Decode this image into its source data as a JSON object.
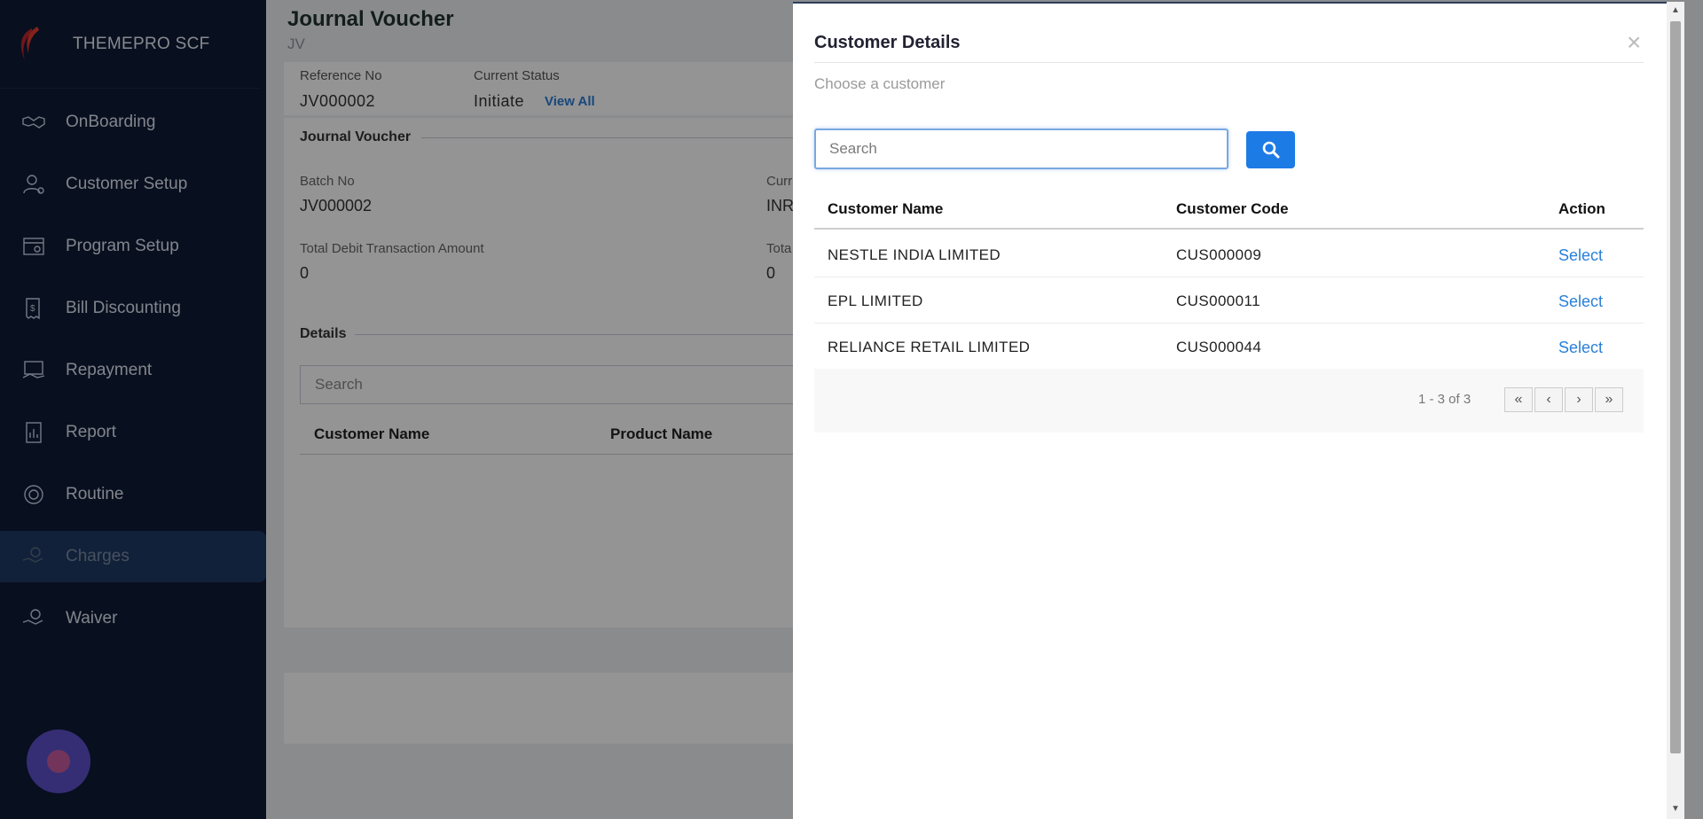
{
  "brand": {
    "name": "THEMEPRO SCF"
  },
  "sidebar": {
    "items": [
      {
        "label": "OnBoarding",
        "icon": "handshake-icon"
      },
      {
        "label": "Customer Setup",
        "icon": "user-gear-icon"
      },
      {
        "label": "Program Setup",
        "icon": "program-icon"
      },
      {
        "label": "Bill Discounting",
        "icon": "bill-icon"
      },
      {
        "label": "Repayment",
        "icon": "repayment-icon"
      },
      {
        "label": "Report",
        "icon": "report-icon"
      },
      {
        "label": "Routine",
        "icon": "routine-icon"
      },
      {
        "label": "Charges",
        "icon": "charges-icon",
        "active": true
      },
      {
        "label": "Waiver",
        "icon": "waiver-icon"
      }
    ]
  },
  "page": {
    "title": "Journal Voucher",
    "subtitle": "JV",
    "reference_label": "Reference No",
    "reference_value": "JV000002",
    "status_label": "Current Status",
    "status_value": "Initiate",
    "view_all": "View All",
    "section_title": "Journal Voucher",
    "batch_label": "Batch No",
    "batch_value": "JV000002",
    "currency_label_partial": "Curr",
    "currency_value_partial": "INR",
    "total_debit_label": "Total Debit Transaction Amount",
    "total_debit_value": "0",
    "total_credit_label_partial": "Tota",
    "total_credit_value": "0",
    "details_title": "Details",
    "details_search_placeholder": "Search",
    "details_columns": [
      "Customer Name",
      "Product Name"
    ]
  },
  "drawer": {
    "title": "Customer Details",
    "close": "×",
    "subtitle": "Choose a customer",
    "search_placeholder": "Search",
    "columns": {
      "name": "Customer Name",
      "code": "Customer Code",
      "action": "Action"
    },
    "rows": [
      {
        "name": "NESTLE INDIA LIMITED",
        "code": "CUS000009",
        "action": "Select"
      },
      {
        "name": "EPL LIMITED",
        "code": "CUS000011",
        "action": "Select"
      },
      {
        "name": "RELIANCE RETAIL LIMITED",
        "code": "CUS000044",
        "action": "Select"
      }
    ],
    "pagination": {
      "info": "1 - 3 of 3",
      "first": "«",
      "prev": "‹",
      "next": "›",
      "last": "»"
    }
  },
  "colors": {
    "sidebar_bg": "#0e1a36",
    "accent": "#1d7be6",
    "link": "#2a7fd8"
  }
}
